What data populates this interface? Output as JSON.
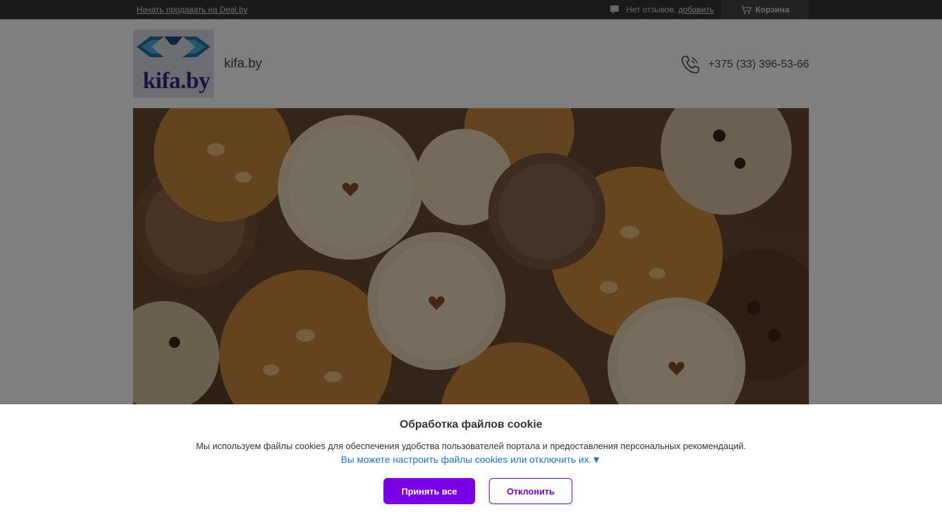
{
  "topbar": {
    "sell_link": "Начать продавать на Deal.by",
    "reviews_text": "Нет отзывов,",
    "reviews_add": "добавить",
    "cart_label": "Корзина"
  },
  "header": {
    "logo_text": "kifa.by",
    "site_name": "kifa.by",
    "phone": "+375 (33) 396-53-66"
  },
  "cookie": {
    "title": "Обработка файлов cookie",
    "text": "Мы используем файлы cookies для обеспечения удобства пользователей портала и предоставления персональных рекомендаций.",
    "settings_link": "Вы можете настроить файлы cookies или отключить их.▼",
    "accept_label": "Принять все",
    "decline_label": "Отклонить"
  },
  "colors": {
    "accent": "#7a00e6",
    "link": "#1a73d8",
    "topbar": "#353535"
  }
}
